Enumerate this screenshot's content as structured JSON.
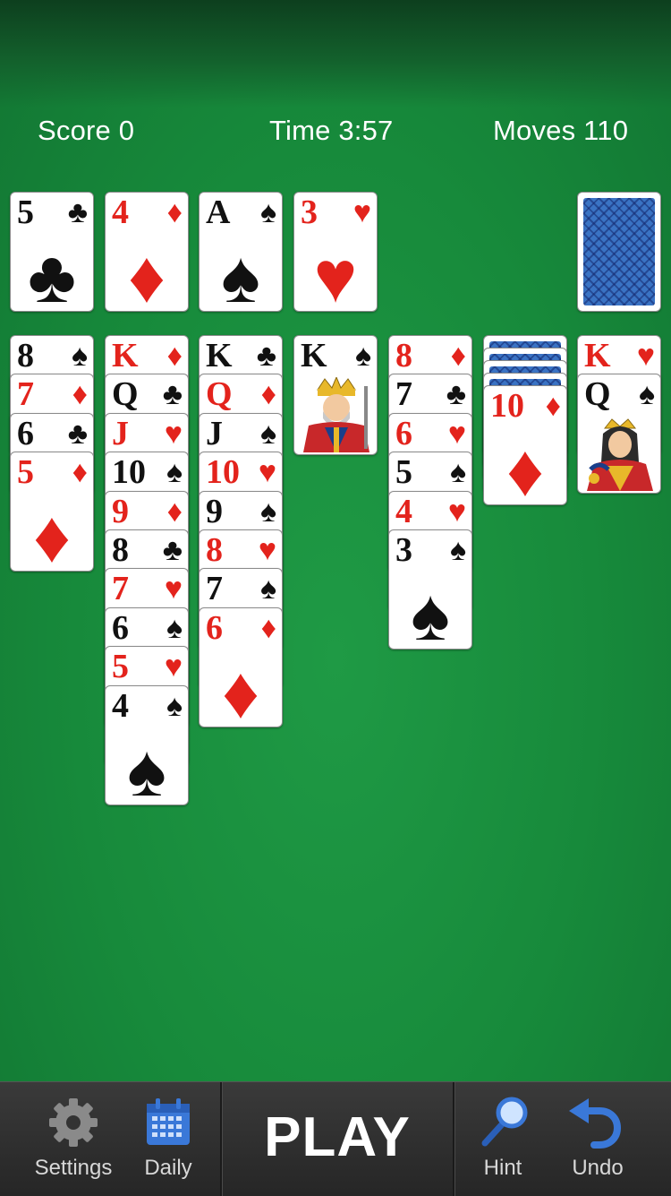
{
  "header": {
    "score_label": "Score 0",
    "time_label": "Time 3:57",
    "moves_label": "Moves 110"
  },
  "foundations": [
    {
      "rank": "5",
      "suit": "♣",
      "color": "black"
    },
    {
      "rank": "4",
      "suit": "♦",
      "color": "red"
    },
    {
      "rank": "A",
      "suit": "♠",
      "color": "black"
    },
    {
      "rank": "3",
      "suit": "♥",
      "color": "red"
    }
  ],
  "stock": {
    "state": "face-down"
  },
  "tableau": [
    {
      "hidden": 0,
      "cards": [
        {
          "rank": "8",
          "suit": "♠",
          "color": "black"
        },
        {
          "rank": "7",
          "suit": "♦",
          "color": "red"
        },
        {
          "rank": "6",
          "suit": "♣",
          "color": "black"
        },
        {
          "rank": "5",
          "suit": "♦",
          "color": "red"
        }
      ]
    },
    {
      "hidden": 0,
      "cards": [
        {
          "rank": "K",
          "suit": "♦",
          "color": "red"
        },
        {
          "rank": "Q",
          "suit": "♣",
          "color": "black"
        },
        {
          "rank": "J",
          "suit": "♥",
          "color": "red"
        },
        {
          "rank": "10",
          "suit": "♠",
          "color": "black"
        },
        {
          "rank": "9",
          "suit": "♦",
          "color": "red"
        },
        {
          "rank": "8",
          "suit": "♣",
          "color": "black"
        },
        {
          "rank": "7",
          "suit": "♥",
          "color": "red"
        },
        {
          "rank": "6",
          "suit": "♠",
          "color": "black"
        },
        {
          "rank": "5",
          "suit": "♥",
          "color": "red"
        },
        {
          "rank": "4",
          "suit": "♠",
          "color": "black"
        }
      ]
    },
    {
      "hidden": 0,
      "cards": [
        {
          "rank": "K",
          "suit": "♣",
          "color": "black"
        },
        {
          "rank": "Q",
          "suit": "♦",
          "color": "red"
        },
        {
          "rank": "J",
          "suit": "♠",
          "color": "black"
        },
        {
          "rank": "10",
          "suit": "♥",
          "color": "red"
        },
        {
          "rank": "9",
          "suit": "♠",
          "color": "black"
        },
        {
          "rank": "8",
          "suit": "♥",
          "color": "red"
        },
        {
          "rank": "7",
          "suit": "♠",
          "color": "black"
        },
        {
          "rank": "6",
          "suit": "♦",
          "color": "red"
        }
      ]
    },
    {
      "hidden": 0,
      "cards": [
        {
          "rank": "K",
          "suit": "♠",
          "color": "black",
          "face": "king"
        }
      ]
    },
    {
      "hidden": 0,
      "cards": [
        {
          "rank": "8",
          "suit": "♦",
          "color": "red"
        },
        {
          "rank": "7",
          "suit": "♣",
          "color": "black"
        },
        {
          "rank": "6",
          "suit": "♥",
          "color": "red"
        },
        {
          "rank": "5",
          "suit": "♠",
          "color": "black"
        },
        {
          "rank": "4",
          "suit": "♥",
          "color": "red"
        },
        {
          "rank": "3",
          "suit": "♠",
          "color": "black"
        }
      ]
    },
    {
      "hidden": 4,
      "cards": [
        {
          "rank": "10",
          "suit": "♦",
          "color": "red"
        }
      ]
    },
    {
      "hidden": 0,
      "cards": [
        {
          "rank": "K",
          "suit": "♥",
          "color": "red"
        },
        {
          "rank": "Q",
          "suit": "♠",
          "color": "black",
          "face": "queen"
        }
      ]
    }
  ],
  "toolbar": {
    "settings_label": "Settings",
    "daily_label": "Daily",
    "play_label": "PLAY",
    "hint_label": "Hint",
    "undo_label": "Undo",
    "settings_icon": "gear-icon",
    "daily_icon": "calendar-icon",
    "hint_icon": "magnifier-icon",
    "undo_icon": "undo-arrow-icon"
  },
  "colors": {
    "felt": "#1a8f3f",
    "red_suit": "#e3231c",
    "black_suit": "#111111",
    "card_back": "#3a73c4",
    "toolbar_bg": "#2e2e2e",
    "icon_blue": "#3a78d8"
  }
}
